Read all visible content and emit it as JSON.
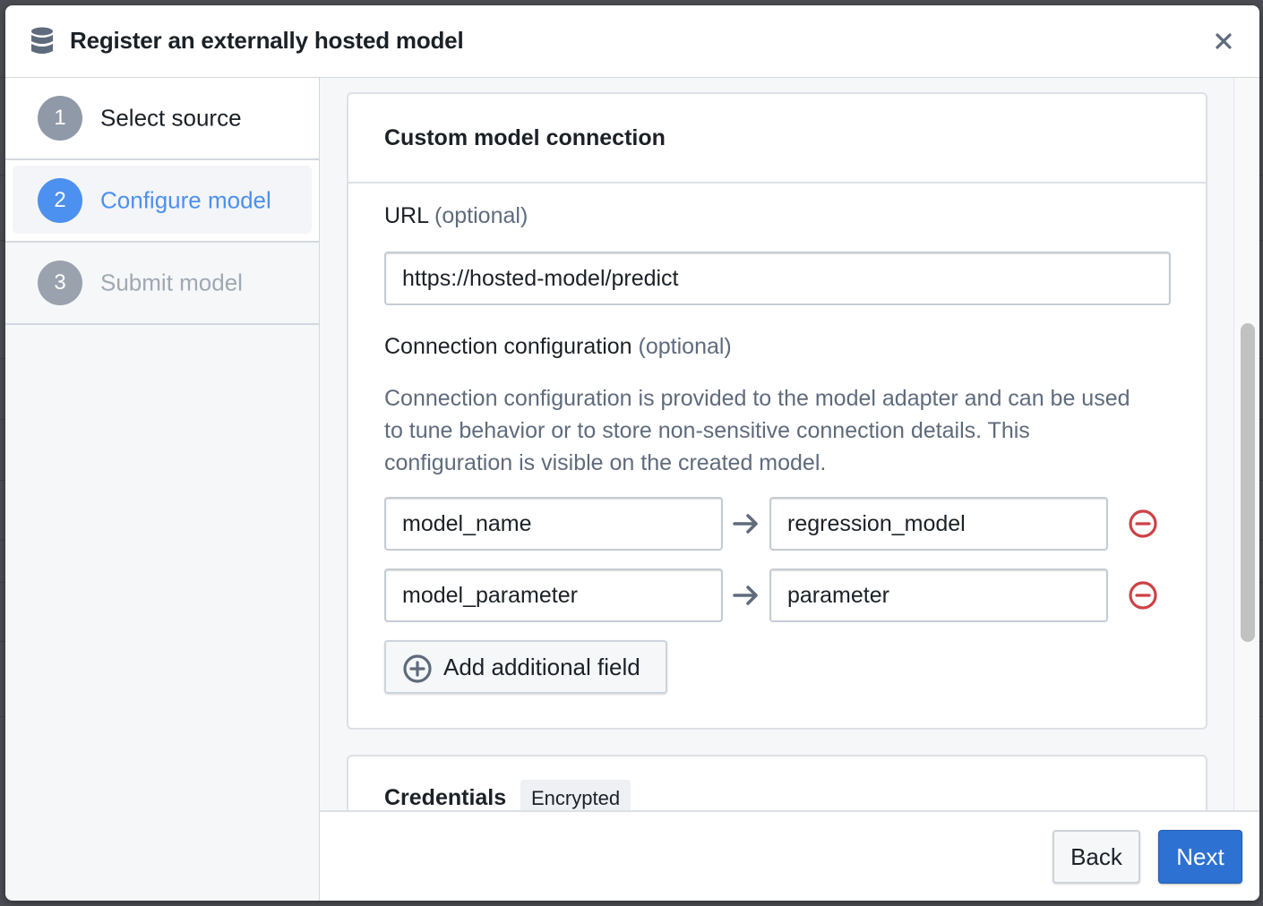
{
  "dialog": {
    "title": "Register an externally hosted model",
    "title_icon": "database-icon",
    "close_icon": "close-icon"
  },
  "steps": [
    {
      "number": "1",
      "label": "Select source",
      "state": "completed"
    },
    {
      "number": "2",
      "label": "Configure model",
      "state": "active"
    },
    {
      "number": "3",
      "label": "Submit model",
      "state": "pending"
    }
  ],
  "connection_card": {
    "title": "Custom model connection",
    "url": {
      "label": "URL",
      "optional": "(optional)",
      "value": "https://hosted-model/predict"
    },
    "config": {
      "label": "Connection configuration",
      "optional": "(optional)",
      "description": "Connection configuration is provided to the model adapter and can be used to tune behavior or to store non-sensitive connection details. This configuration is visible on the created model.",
      "entries": [
        {
          "key": "model_name",
          "value": "regression_model"
        },
        {
          "key": "model_parameter",
          "value": "parameter"
        }
      ],
      "add_label": "Add additional field"
    }
  },
  "credentials_card": {
    "title": "Credentials",
    "badge": "Encrypted"
  },
  "footer": {
    "back_label": "Back",
    "next_label": "Next"
  },
  "colors": {
    "accent": "#2d72d2",
    "active_step": "#4c90f0",
    "danger": "#cd4246"
  }
}
